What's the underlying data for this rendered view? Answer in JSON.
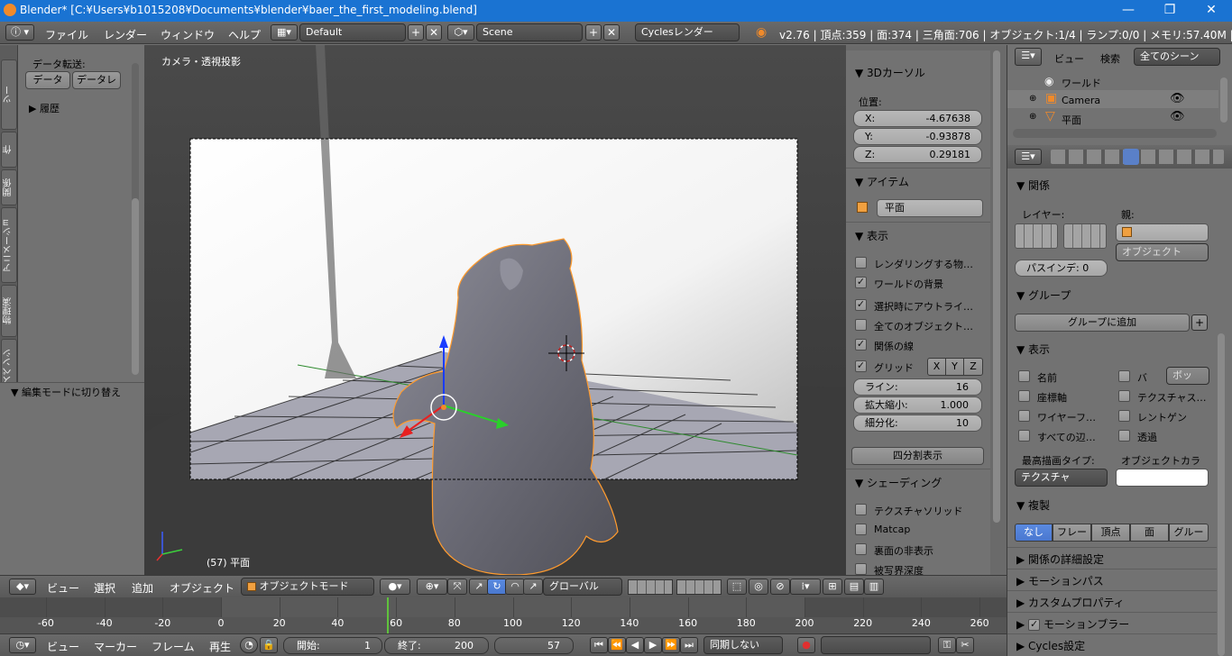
{
  "window": {
    "title": "Blender* [C:¥Users¥b1015208¥Documents¥blender¥baer_the_first_modeling.blend]",
    "min": "—",
    "max": "❐",
    "close": "✕"
  },
  "menubar": {
    "items": [
      "ファイル",
      "レンダー",
      "ウィンドウ",
      "ヘルプ"
    ],
    "layout": "Default",
    "scene": "Scene",
    "engine": "Cyclesレンダー",
    "stats": "v2.76 | 頂点:359 | 面:374 | 三角面:706 | オブジェクト:1/4 | ランプ:0/0 | メモリ:57.40M | 平面"
  },
  "left_tabs": [
    "ツー",
    "作",
    "関係",
    "アニメーショ",
    "物理演",
    "グリースペンシ"
  ],
  "left_panel": {
    "data_transfer_label": "データ転送:",
    "data_btn": "データ",
    "data_layer_btn": "データレ",
    "history": "履歴",
    "operator": "編集モードに切り替え"
  },
  "viewport": {
    "view_label": "カメラ・透視投影",
    "object_label": "(57) 平面"
  },
  "n_panel": {
    "cursor_title": "3Dカーソル",
    "location_label": "位置:",
    "x_label": "X:",
    "x": "-4.67638",
    "y_label": "Y:",
    "y": "-0.93878",
    "z_label": "Z:",
    "z": "0.29181",
    "item_title": "アイテム",
    "item_name": "平面",
    "display_title": "表示",
    "display_items": [
      {
        "label": "レンダリングする物…",
        "checked": false
      },
      {
        "label": "ワールドの背景",
        "checked": true
      },
      {
        "label": "選択時にアウトライ…",
        "checked": true
      },
      {
        "label": "全てのオブジェクト…",
        "checked": false
      },
      {
        "label": "関係の線",
        "checked": true
      }
    ],
    "grid_label": "グリッド",
    "grid_axes": [
      "X",
      "Y",
      "Z"
    ],
    "lines_label": "ライン:",
    "lines": "16",
    "scale_label": "拡大縮小:",
    "scale": "1.000",
    "subdiv_label": "細分化:",
    "subdiv": "10",
    "quad_view": "四分割表示",
    "shading_title": "シェーディング",
    "shading_items": [
      {
        "label": "テクスチャソリッド",
        "checked": false
      },
      {
        "label": "Matcap",
        "checked": false
      },
      {
        "label": "裏面の非表示",
        "checked": false
      },
      {
        "label": "被写界深度",
        "checked": false
      }
    ]
  },
  "outliner": {
    "view": "ビュー",
    "search": "検索",
    "filter": "全てのシーン",
    "rows": [
      "ワールド",
      "Camera",
      "平面"
    ]
  },
  "properties": {
    "relations_title": "関係",
    "layer_label": "レイヤー:",
    "parent_label": "親:",
    "parent_type": "オブジェクト",
    "pass_index": "パスインデ: 0",
    "groups_title": "グループ",
    "add_to_group": "グループに追加",
    "display_title": "表示",
    "display_left": [
      "名前",
      "座標軸",
      "ワイヤーフ…",
      "すべての辺…"
    ],
    "display_right": [
      "バ",
      "テクスチャス…",
      "レントゲン",
      "透過"
    ],
    "bound_type": "ボッ",
    "max_draw_label": "最高描画タイプ:",
    "object_color_label": "オブジェクトカラ",
    "max_draw": "テクスチャ",
    "dupli_title": "複製",
    "dupli_options": [
      "なし",
      "フレー",
      "頂点",
      "面",
      "グルー"
    ],
    "collapsed": [
      "関係の詳細設定",
      "モーションパス",
      "カスタムプロパティ",
      "モーションブラー",
      "Cycles設定"
    ]
  },
  "viewport_header": {
    "view": "ビュー",
    "select": "選択",
    "add": "追加",
    "object": "オブジェクト",
    "mode": "オブジェクトモード",
    "orientation": "グローバル"
  },
  "timeline": {
    "ticks": [
      "-60",
      "-40",
      "-20",
      "0",
      "20",
      "40",
      "60",
      "80",
      "100",
      "120",
      "140",
      "160",
      "180",
      "200",
      "220",
      "240",
      "260"
    ],
    "current_frame_value": 57
  },
  "timeline_header": {
    "view": "ビュー",
    "marker": "マーカー",
    "frame": "フレーム",
    "play": "再生",
    "start_label": "開始:",
    "start": "1",
    "end_label": "終了:",
    "end": "200",
    "current": "57",
    "sync": "同期しない"
  }
}
